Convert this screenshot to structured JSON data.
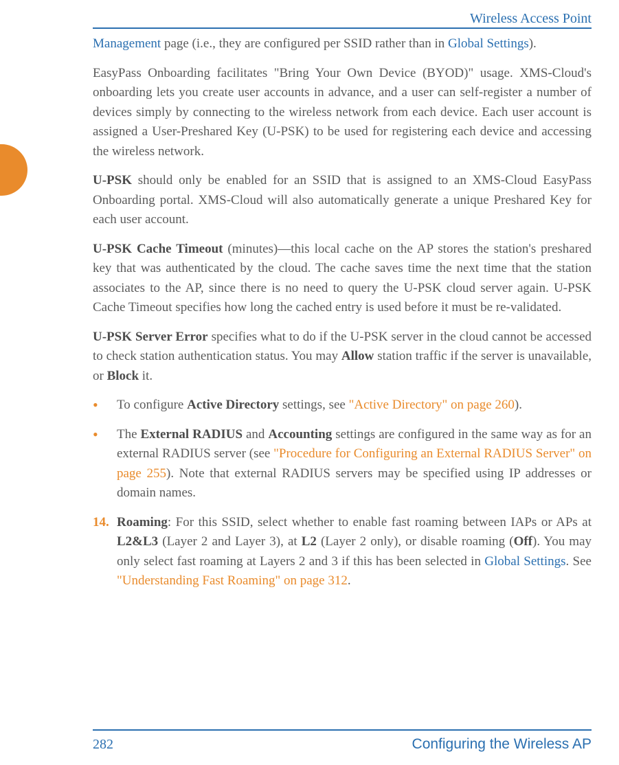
{
  "header": {
    "title": "Wireless Access Point"
  },
  "footer": {
    "page_number": "282",
    "section": "Configuring the Wireless AP"
  },
  "body": {
    "p1_link_management": "Management",
    "p1_mid": " page (i.e., they are configured per SSID rather than in ",
    "p1_link_global": "Global Settings",
    "p1_end": ").",
    "p2": "EasyPass Onboarding facilitates \"Bring Your Own Device (BYOD)\" usage. XMS-Cloud's onboarding lets you create user accounts in advance, and a user can self-register a number of devices simply by connecting to the wireless network from each device. Each user account is assigned a User-Preshared Key (U-PSK) to be used for registering each device and accessing the wireless network.",
    "p3_bold": "U-PSK",
    "p3_rest": " should only be enabled for an SSID that is assigned to an XMS-Cloud EasyPass Onboarding portal. XMS-Cloud will also automatically generate a unique Preshared Key for each user account.",
    "p4_bold": "U-PSK Cache Timeout",
    "p4_rest": " (minutes)—this local cache on the AP stores the station's preshared key that was authenticated by the cloud. The cache saves time the next time that the station associates to the AP, since there is no need to query the U-PSK cloud server again. U-PSK Cache Timeout specifies how long the cached entry is used before it must be re-validated.",
    "p5_bold": "U-PSK Server Error",
    "p5_mid1": " specifies what to do if the U-PSK server in the cloud cannot be accessed to check station authentication status. You may ",
    "p5_allow": "Allow",
    "p5_mid2": " station traffic if the server is unavailable, or ",
    "p5_block": "Block",
    "p5_end": " it.",
    "b1_pre": "To configure ",
    "b1_bold": "Active Directory",
    "b1_mid": " settings, see ",
    "b1_link": "\"Active Directory\" on page 260",
    "b1_end": ").",
    "b2_pre": "The ",
    "b2_bold1": "External RADIUS",
    "b2_and": " and ",
    "b2_bold2": "Accounting",
    "b2_mid": " settings are configured in the same way as for an external RADIUS server (see ",
    "b2_link": "\"Procedure for Configuring an External RADIUS Server\" on page 255",
    "b2_end": "). Note that external RADIUS servers may be specified using IP addresses or domain names.",
    "n14_num": "14.",
    "n14_bold1": "Roaming",
    "n14_t1": ": For this SSID, select whether to enable fast roaming between IAPs or APs at ",
    "n14_bold2": "L2&L3",
    "n14_t2": " (Layer 2 and Layer 3), at ",
    "n14_bold3": "L2",
    "n14_t3": " (Layer 2 only), or disable roaming (",
    "n14_bold4": "Off",
    "n14_t4": "). You may only select fast roaming at Layers 2 and 3 if this has been selected in ",
    "n14_link_global": "Global Settings",
    "n14_t5": ". See ",
    "n14_link_fast": "\"Understanding Fast Roaming\" on page 312",
    "n14_t6": "."
  }
}
